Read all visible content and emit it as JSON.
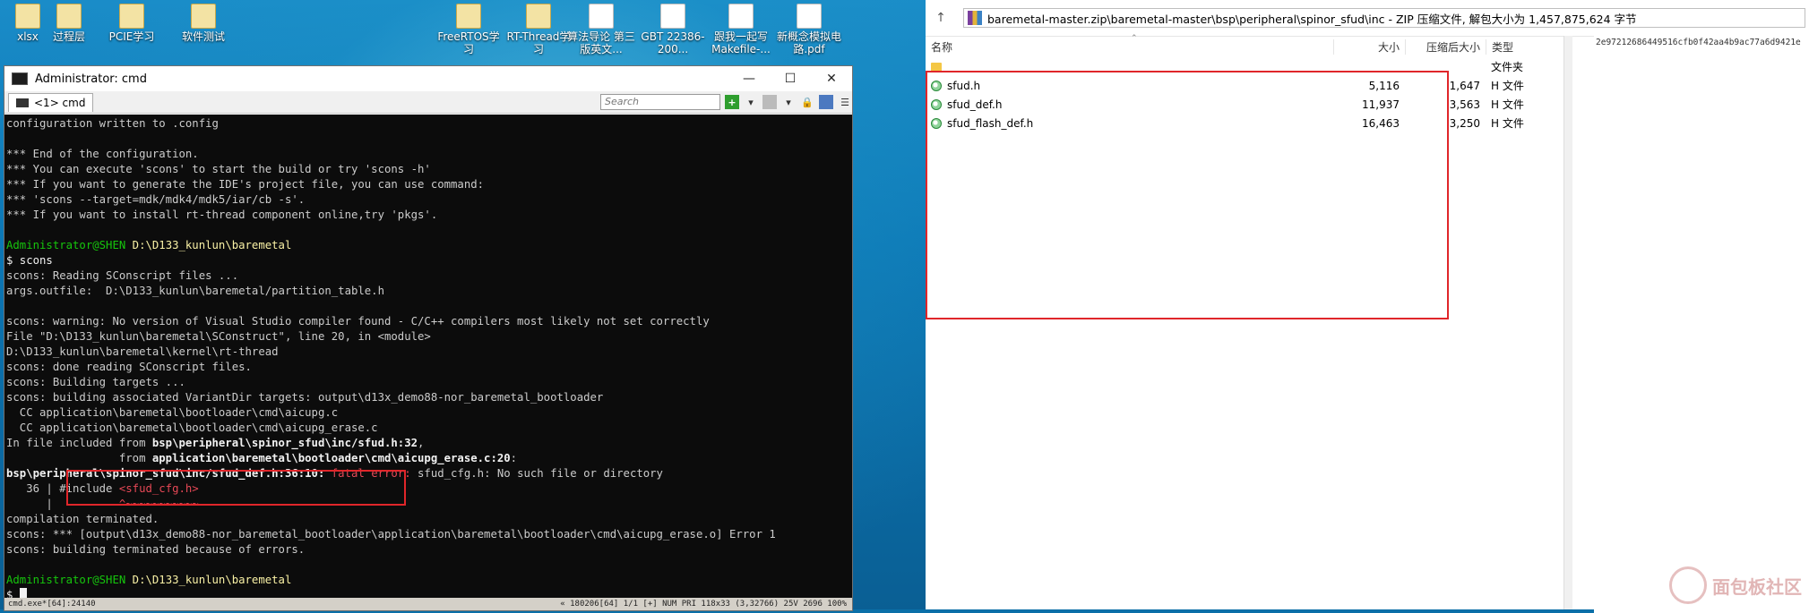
{
  "desktop": {
    "icons": [
      {
        "label": "xlsx",
        "type": "folder"
      },
      {
        "label": "过程层",
        "type": "folder"
      },
      {
        "label": "PCIE学习",
        "type": "folder"
      },
      {
        "label": "软件测试",
        "type": "folder"
      },
      {
        "label": "FreeRTOS学习",
        "type": "folder"
      },
      {
        "label": "RT-Thread学习",
        "type": "folder"
      },
      {
        "label": "算法导论 第三版英文...",
        "type": "doc"
      },
      {
        "label": "GBT 22386-200...",
        "type": "doc"
      },
      {
        "label": "跟我一起写Makefile-...",
        "type": "doc"
      },
      {
        "label": "新概念模拟电路.pdf",
        "type": "doc"
      }
    ]
  },
  "cmd": {
    "title": "Administrator: cmd",
    "tab_label": "<1> cmd",
    "search_placeholder": "Search",
    "minimize": "—",
    "maximize": "☐",
    "close": "✕",
    "lines": [
      [
        {
          "t": "configuration written to .config",
          "c": ""
        }
      ],
      [
        {
          "t": "",
          "c": ""
        }
      ],
      [
        {
          "t": "*** End of the configuration.",
          "c": ""
        }
      ],
      [
        {
          "t": "*** You can execute 'scons' to start the build or try 'scons -h'",
          "c": ""
        }
      ],
      [
        {
          "t": "*** If you want to generate the IDE's project file, you can use command:",
          "c": ""
        }
      ],
      [
        {
          "t": "*** 'scons --target=mdk/mdk4/mdk5/iar/cb -s'.",
          "c": ""
        }
      ],
      [
        {
          "t": "*** If you want to install rt-thread component online,try 'pkgs'.",
          "c": ""
        }
      ],
      [
        {
          "t": "",
          "c": ""
        }
      ],
      [
        {
          "t": "Administrator@SHEN ",
          "c": "t-green"
        },
        {
          "t": "D:\\D133_kunlun\\baremetal",
          "c": "t-yellow"
        }
      ],
      [
        {
          "t": "$ scons",
          "c": "t-white"
        }
      ],
      [
        {
          "t": "scons: Reading SConscript files ...",
          "c": ""
        }
      ],
      [
        {
          "t": "args.outfile:  D:\\D133_kunlun\\baremetal/partition_table.h",
          "c": ""
        }
      ],
      [
        {
          "t": "",
          "c": ""
        }
      ],
      [
        {
          "t": "scons: warning: No version of Visual Studio compiler found - C/C++ compilers most likely not set correctly",
          "c": ""
        }
      ],
      [
        {
          "t": "File \"D:\\D133_kunlun\\baremetal\\SConstruct\", line 20, in <module>",
          "c": ""
        }
      ],
      [
        {
          "t": "D:\\D133_kunlun\\baremetal\\kernel\\rt-thread",
          "c": ""
        }
      ],
      [
        {
          "t": "scons: done reading SConscript files.",
          "c": ""
        }
      ],
      [
        {
          "t": "scons: Building targets ...",
          "c": ""
        }
      ],
      [
        {
          "t": "scons: building associated VariantDir targets: output\\d13x_demo88-nor_baremetal_bootloader",
          "c": ""
        }
      ],
      [
        {
          "t": "  CC application\\baremetal\\bootloader\\cmd\\aicupg.c",
          "c": ""
        }
      ],
      [
        {
          "t": "  CC application\\baremetal\\bootloader\\cmd\\aicupg_erase.c",
          "c": ""
        }
      ],
      [
        {
          "t": "In file included from ",
          "c": ""
        },
        {
          "t": "bsp\\peripheral\\spinor_sfud\\inc/sfud.h:32",
          "c": "t-bold"
        },
        {
          "t": ",",
          "c": ""
        }
      ],
      [
        {
          "t": "                 from ",
          "c": ""
        },
        {
          "t": "application\\baremetal\\bootloader\\cmd\\aicupg_erase.c:20",
          "c": "t-bold"
        },
        {
          "t": ":",
          "c": ""
        }
      ],
      [
        {
          "t": "bsp\\peripheral\\spinor_sfud\\inc/sfud_def.h:36:10:",
          "c": "t-bold"
        },
        {
          "t": " fatal error: ",
          "c": "t-red"
        },
        {
          "t": "sfud_cfg.h: No such file or directory",
          "c": ""
        }
      ],
      [
        {
          "t": "   36 | #include ",
          "c": ""
        },
        {
          "t": "<sfud_cfg.h>",
          "c": "t-red"
        }
      ],
      [
        {
          "t": "      |          ",
          "c": ""
        },
        {
          "t": "^~~~~~~~~~~~",
          "c": "t-red"
        }
      ],
      [
        {
          "t": "compilation terminated.",
          "c": ""
        }
      ],
      [
        {
          "t": "scons: *** [output\\d13x_demo88-nor_baremetal_bootloader\\application\\baremetal\\bootloader\\cmd\\aicupg_erase.o] Error 1",
          "c": ""
        }
      ],
      [
        {
          "t": "scons: building terminated because of errors.",
          "c": ""
        }
      ],
      [
        {
          "t": "",
          "c": ""
        }
      ],
      [
        {
          "t": "Administrator@SHEN ",
          "c": "t-green"
        },
        {
          "t": "D:\\D133_kunlun\\baremetal",
          "c": "t-yellow"
        }
      ],
      [
        {
          "t": "$ ",
          "c": "t-white"
        }
      ]
    ],
    "status_left": "cmd.exe*[64]:24140",
    "status_right": "« 180206[64]  1/1  [+] NUM  PRI  118x33  (3,32766) 25V  2696  100%"
  },
  "archive": {
    "path": "baremetal-master.zip\\baremetal-master\\bsp\\peripheral\\spinor_sfud\\inc - ZIP 压缩文件, 解包大小为 1,457,875,624 字节",
    "columns": {
      "name": "名称",
      "size": "大小",
      "packed": "压缩后大小",
      "type": "类型"
    },
    "rows": [
      {
        "name": "",
        "size": "",
        "packed": "",
        "type": "文件夹",
        "kind": "folder"
      },
      {
        "name": "sfud.h",
        "size": "5,116",
        "packed": "1,647",
        "type": "H 文件",
        "kind": "file"
      },
      {
        "name": "sfud_def.h",
        "size": "11,937",
        "packed": "3,563",
        "type": "H 文件",
        "kind": "file"
      },
      {
        "name": "sfud_flash_def.h",
        "size": "16,463",
        "packed": "3,250",
        "type": "H 文件",
        "kind": "file"
      }
    ],
    "hash_text": "2e97212686449516cfb0f42aa4b9ac77a6d9421e"
  },
  "watermark": {
    "text": "面包板社区"
  }
}
